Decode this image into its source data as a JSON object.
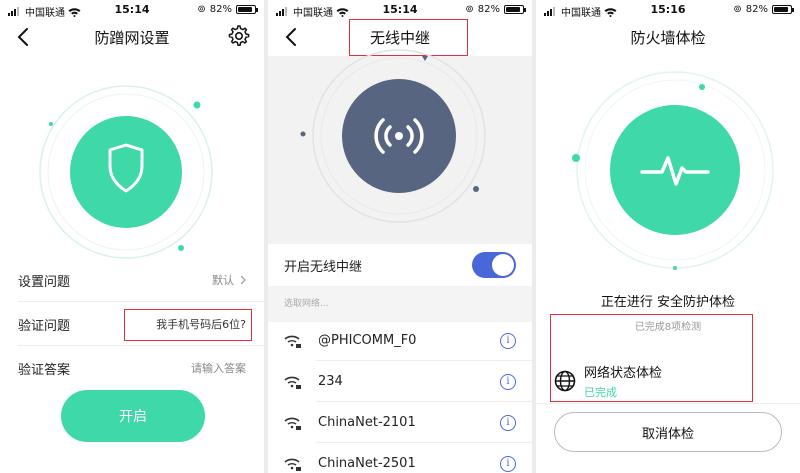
{
  "status_bar": {
    "carrier": "中国联通",
    "battery": "82%",
    "times": [
      "15:14",
      "15:14",
      "15:16"
    ]
  },
  "panel1": {
    "title": "防蹭网设置",
    "rows": [
      {
        "label": "设置问题",
        "value": "默认"
      },
      {
        "label": "验证问题",
        "value": "我手机号码后6位?"
      },
      {
        "label": "验证答案",
        "placeholder": "请输入答案"
      }
    ],
    "button": "开启"
  },
  "panel2": {
    "title": "无线中继",
    "toggle_label": "开启无线中继",
    "toggle_on": true,
    "section_hint": "选取网络...",
    "networks": [
      "@PHICOMM_F0",
      "234",
      "ChinaNet-2101",
      "ChinaNet-2501"
    ]
  },
  "panel3": {
    "title": "防火墙体检",
    "status_text": "正在进行 安全防护体检",
    "progress_text": "已完成8项检测",
    "check_item": {
      "title": "网络状态体检",
      "status": "已完成"
    },
    "cancel_button": "取消体检"
  },
  "colors": {
    "accent_green": "#3fd8a8",
    "accent_blue": "#4a67d8",
    "highlight_red": "#e0303a",
    "circle_dark": "#586580"
  },
  "icons": [
    "signal-icon",
    "wifi-icon",
    "lock-rotation-icon",
    "battery-icon",
    "back-icon",
    "gear-icon",
    "shield-icon",
    "wireless-signal-icon",
    "pulse-icon",
    "globe-icon",
    "chevron-right-icon",
    "info-icon"
  ]
}
